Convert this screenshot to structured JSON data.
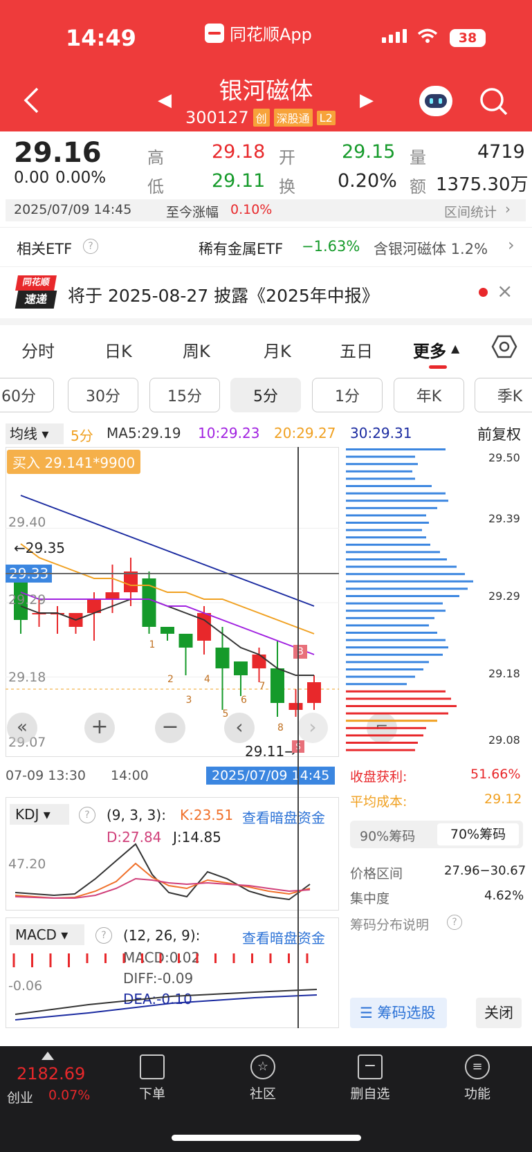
{
  "status_bar": {
    "time": "14:49",
    "battery": "38"
  },
  "app_name": "同花顺App",
  "stock": {
    "name": "银河磁体",
    "code": "300127",
    "tags": [
      "创",
      "深股通",
      "L2"
    ]
  },
  "quote": {
    "price": "29.16",
    "change": "0.00",
    "change_pct": "0.00%",
    "high_label": "高",
    "high": "29.18",
    "open_label": "开",
    "open": "29.15",
    "vol_label": "量",
    "vol": "4719",
    "low_label": "低",
    "low": "29.11",
    "turnover_label": "换",
    "turnover": "0.20%",
    "amount_label": "额",
    "amount": "1375.30万",
    "datetime": "2025/07/09 14:45",
    "ytd_label": "至今涨幅",
    "ytd": "0.10%",
    "range_stats": "区间统计"
  },
  "etf": {
    "label": "相关ETF",
    "name": "稀有金属ETF",
    "pct": "−1.63%",
    "hold": "含银河磁体  1.2%"
  },
  "notice": {
    "logo_top": "同花顺",
    "logo_bottom": "速递",
    "text": "将于 2025-08-27 披露《2025年中报》"
  },
  "tabs": [
    "分时",
    "日K",
    "周K",
    "月K",
    "五日",
    "更多"
  ],
  "periods": [
    "60分",
    "30分",
    "15分",
    "5分",
    "1分",
    "年K",
    "季K"
  ],
  "ma_bar": {
    "type": "均线",
    "period": "5分",
    "ma5": "MA5:29.19",
    "ma10": "10:29.23",
    "ma20": "20:29.27",
    "ma30": "30:29.31",
    "adjust": "前复权"
  },
  "chart": {
    "buy_tag": "买入 29.141*9900",
    "y_labels": [
      "29.50",
      "29.40",
      "29.29",
      "29.18",
      "29.07"
    ],
    "hi_marker": "←29.35",
    "lo_marker": "29.11→",
    "cur_price": "29.33",
    "x_labels": [
      "07-09 13:30",
      "14:00"
    ],
    "cursor_time": "2025/07/09 14:45",
    "b_mark": "B",
    "s_mark": "S",
    "marker_nums": [
      "1",
      "2",
      "3",
      "4",
      "5",
      "6",
      "7",
      "8"
    ]
  },
  "chart_data": {
    "type": "candlestick",
    "ylim": [
      29.07,
      29.5
    ],
    "candles": [
      {
        "o": 29.33,
        "c": 29.26,
        "h": 29.33,
        "l": 29.24
      },
      {
        "o": 29.27,
        "c": 29.27,
        "h": 29.29,
        "l": 29.25
      },
      {
        "o": 29.27,
        "c": 29.27,
        "h": 29.28,
        "l": 29.24
      },
      {
        "o": 29.25,
        "c": 29.27,
        "h": 29.27,
        "l": 29.24
      },
      {
        "o": 29.27,
        "c": 29.29,
        "h": 29.3,
        "l": 29.23
      },
      {
        "o": 29.29,
        "c": 29.3,
        "h": 29.34,
        "l": 29.27
      },
      {
        "o": 29.3,
        "c": 29.33,
        "h": 29.35,
        "l": 29.28
      },
      {
        "o": 29.32,
        "c": 29.25,
        "h": 29.33,
        "l": 29.24
      },
      {
        "o": 29.25,
        "c": 29.24,
        "h": 29.25,
        "l": 29.23
      },
      {
        "o": 29.24,
        "c": 29.22,
        "h": 29.24,
        "l": 29.18
      },
      {
        "o": 29.23,
        "c": 29.27,
        "h": 29.28,
        "l": 29.21
      },
      {
        "o": 29.22,
        "c": 29.19,
        "h": 29.25,
        "l": 29.13
      },
      {
        "o": 29.2,
        "c": 29.18,
        "h": 29.2,
        "l": 29.15
      },
      {
        "o": 29.19,
        "c": 29.21,
        "h": 29.22,
        "l": 29.17
      },
      {
        "o": 29.19,
        "c": 29.14,
        "h": 29.23,
        "l": 29.12
      },
      {
        "o": 29.13,
        "c": 29.14,
        "h": 29.16,
        "l": 29.12
      },
      {
        "o": 29.14,
        "c": 29.17,
        "h": 29.18,
        "l": 29.13
      }
    ],
    "ma5": [
      29.28,
      29.27,
      29.27,
      29.26,
      29.27,
      29.28,
      29.29,
      29.29,
      29.28,
      29.27,
      29.26,
      29.24,
      29.22,
      29.21,
      29.19,
      29.18,
      29.18
    ],
    "ma10": [
      29.3,
      29.29,
      29.29,
      29.29,
      29.29,
      29.29,
      29.29,
      29.29,
      29.28,
      29.28,
      29.27,
      29.26,
      29.25,
      29.24,
      29.23,
      29.22,
      29.21
    ],
    "ma20": [
      29.37,
      29.35,
      29.34,
      29.33,
      29.32,
      29.32,
      29.31,
      29.31,
      29.3,
      29.3,
      29.29,
      29.29,
      29.28,
      29.27,
      29.26,
      29.25,
      29.24
    ],
    "ma30": [
      29.44,
      29.43,
      29.42,
      29.41,
      29.4,
      29.39,
      29.38,
      29.37,
      29.36,
      29.35,
      29.34,
      29.33,
      29.32,
      29.31,
      29.3,
      29.29,
      29.28
    ]
  },
  "chips": {
    "y_labels": [
      "29.50",
      "29.39",
      "29.29",
      "29.18",
      "29.08"
    ],
    "profit_label": "收盘获利:",
    "profit": "51.66%",
    "cost_label": "平均成本:",
    "cost": "29.12",
    "tab90": "90%筹码",
    "tab70": "70%筹码",
    "range_label": "价格区间",
    "range": "27.96−30.67",
    "conc_label": "集中度",
    "conc": "4.62%",
    "desc": "筹码分布说明",
    "select_btn": "筹码选股",
    "close_btn": "关闭",
    "bars_blue": [
      0.72,
      0.5,
      0.52,
      0.48,
      0.5,
      0.62,
      0.72,
      0.74,
      0.66,
      0.58,
      0.6,
      0.55,
      0.58,
      0.61,
      0.68,
      0.73,
      0.8,
      0.86,
      0.92,
      0.88,
      0.82,
      0.7,
      0.72,
      0.64,
      0.6,
      0.66,
      0.72,
      0.74,
      0.7,
      0.6,
      0.56,
      0.5,
      0.44
    ],
    "bars_red": [
      0.72,
      0.76,
      0.8,
      0.74,
      0.66,
      0.58,
      0.56,
      0.52,
      0.5
    ]
  },
  "kdj": {
    "name": "KDJ",
    "params": "(9, 3, 3):",
    "k": "K:23.51",
    "d": "D:27.84",
    "j": "J:14.85",
    "link": "查看暗盘资金",
    "y": "47.20"
  },
  "macd": {
    "name": "MACD",
    "params": "(12, 26, 9):",
    "macd": "MACD:0.02",
    "diff": "DIFF:-0.09",
    "dea": "DEA:-0.10",
    "link": "查看暗盘资金",
    "y": "-0.06"
  },
  "bottom": {
    "index_value": "2182.69",
    "index_name": "创业",
    "index_pct": "0.07%",
    "items": [
      "下单",
      "社区",
      "删自选",
      "功能"
    ]
  }
}
